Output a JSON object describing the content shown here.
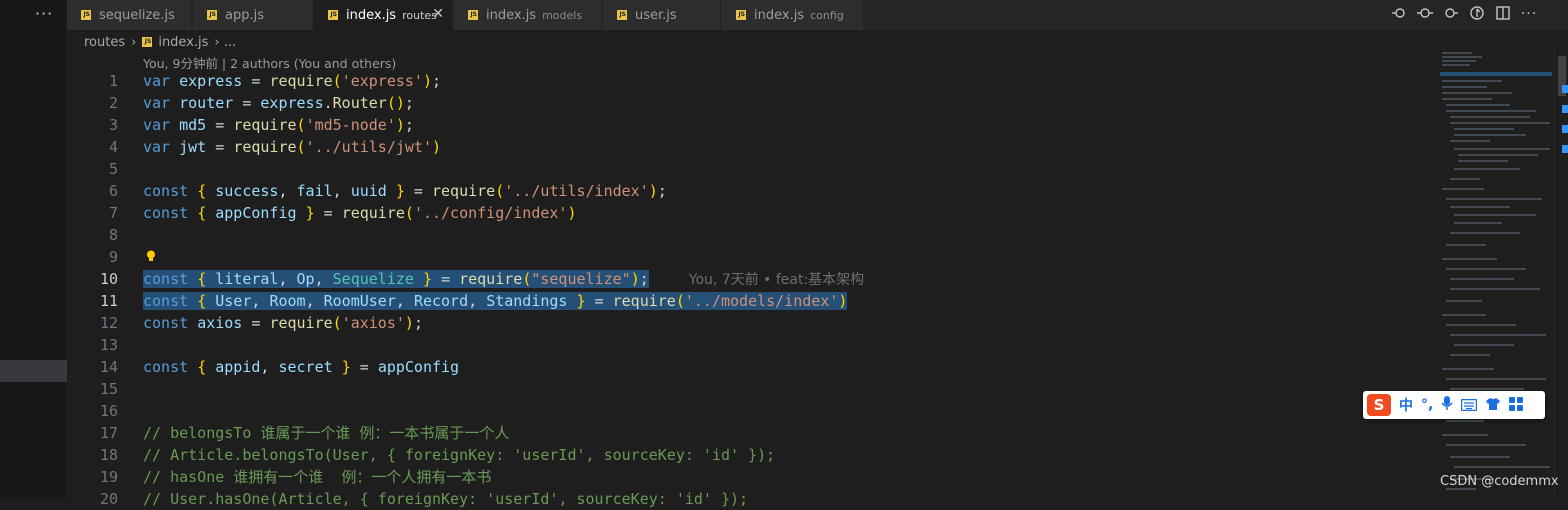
{
  "activity": {
    "more_label": "···"
  },
  "tabs": [
    {
      "name": "sequelize.js",
      "desc": "",
      "active": false
    },
    {
      "name": "app.js",
      "desc": "",
      "active": false
    },
    {
      "name": "index.js",
      "desc": "routes",
      "active": true
    },
    {
      "name": "index.js",
      "desc": "models",
      "active": false
    },
    {
      "name": "user.js",
      "desc": "",
      "active": false
    },
    {
      "name": "index.js",
      "desc": "config",
      "active": false
    }
  ],
  "tab_close": "✕",
  "js_badge": "JS",
  "breadcrumb": {
    "folder": "routes",
    "sep": "›",
    "file": "index.js",
    "more": "›  ..."
  },
  "codelens": "You, 9分钟前 | 2 authors (You and others)",
  "editor": {
    "current_line": 10,
    "line_numbers": [
      "1",
      "2",
      "3",
      "4",
      "5",
      "6",
      "7",
      "8",
      "9",
      "10",
      "11",
      "12",
      "13",
      "14",
      "15",
      "16",
      "17",
      "18",
      "19",
      "20"
    ],
    "blame_line10": "You, 7天前 • feat:基本架构",
    "comments": {
      "c17": "// belongsTo 谁属于一个谁 例：一本书属于一个人",
      "c18": "// Article.belongsTo(User, { foreignKey: 'userId', sourceKey: 'id' });",
      "c19": "// hasOne 谁拥有一个谁  例：一个人拥有一本书",
      "c20": "// User.hasOne(Article, { foreignKey: 'userId', sourceKey: 'id' });"
    }
  },
  "ime": {
    "label": "中"
  },
  "watermark": "CSDN @codemmx",
  "colors": {
    "selection": "#264f78",
    "keyword": "#569cd6",
    "string": "#ce9178",
    "comment": "#6a9955"
  }
}
